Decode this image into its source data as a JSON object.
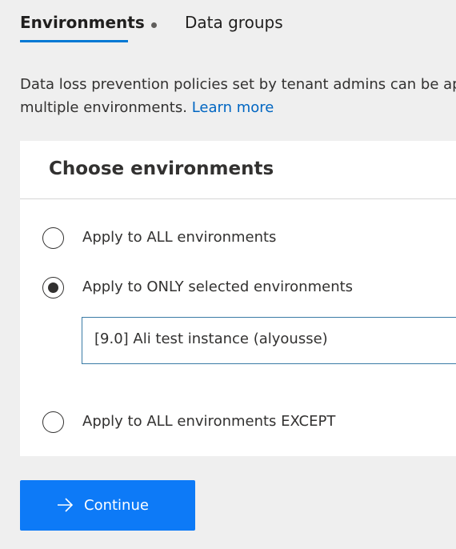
{
  "tabs": {
    "environments": "Environments",
    "data_groups": "Data groups"
  },
  "description": {
    "line1": "Data loss prevention policies set by tenant admins can be applied to",
    "line2": "multiple environments.",
    "learn_more": "Learn more"
  },
  "panel": {
    "title": "Choose environments",
    "options": [
      {
        "label": "Apply to ALL environments",
        "selected": false
      },
      {
        "label": "Apply to ONLY selected environments",
        "selected": true
      },
      {
        "label": "Apply to ALL environments EXCEPT",
        "selected": false
      }
    ],
    "selected_environment": "[9.0] Ali test instance (alyousse)"
  },
  "continue_button": {
    "label": "Continue",
    "icon": "arrow-right-icon"
  },
  "colors": {
    "accent": "#0078d4",
    "button": "#0d7af7",
    "link": "#0066c2"
  }
}
